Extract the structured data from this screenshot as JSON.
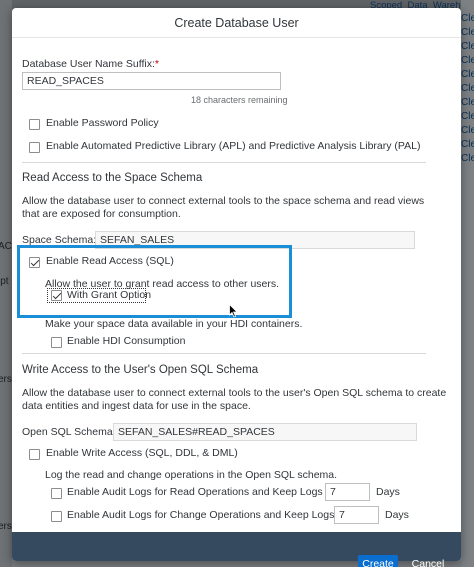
{
  "background": {
    "top_link": "Scoped_Data_Warehouse_C",
    "right_items": [
      "Cle",
      "Cle",
      "Cle",
      "Cle",
      "Cle",
      "Cle",
      "Cle",
      "Cle",
      "Cle",
      "Cle",
      "Cle"
    ],
    "left_fragments": [
      "AC",
      "ipt",
      "ers",
      "ers"
    ]
  },
  "dialog": {
    "title": "Create Database User",
    "suffix": {
      "label": "Database User Name Suffix:",
      "required_mark": "*",
      "value": "READ_SPACES",
      "remaining": "18 characters remaining"
    },
    "enable_password_policy": {
      "label": "Enable Password Policy",
      "checked": false
    },
    "enable_apl": {
      "label": "Enable Automated Predictive Library (APL) and Predictive Analysis Library (PAL)",
      "checked": false
    },
    "read_access": {
      "title": "Read Access to the Space Schema",
      "description": "Allow the database user to connect external tools to the space schema and read views that are exposed for consumption.",
      "schema_label": "Space Schema:",
      "schema_value": "SEFAN_SALES",
      "enable_read": {
        "label": "Enable Read Access (SQL)",
        "checked": true
      },
      "grant_description": "Allow the user to grant read access to other users.",
      "with_grant": {
        "label": "With Grant Option",
        "checked": true
      },
      "hdi_description": "Make your space data available in your HDI containers.",
      "enable_hdi": {
        "label": "Enable HDI Consumption",
        "checked": false
      }
    },
    "write_access": {
      "title": "Write Access to the User's Open SQL Schema",
      "description": "Allow the database user to connect external tools to the user's Open SQL schema to create data entities and ingest data for use in the space.",
      "schema_label": "Open SQL Schema:",
      "schema_value": "SEFAN_SALES#READ_SPACES",
      "enable_write": {
        "label": "Enable Write Access (SQL, DDL, & DML)",
        "checked": false
      },
      "log_description": "Log the read and change operations in the Open SQL schema.",
      "audit_read": {
        "label": "Enable Audit Logs for Read Operations and Keep Logs for",
        "days": "7",
        "unit": "Days",
        "checked": false
      },
      "audit_change": {
        "label": "Enable Audit Logs for Change Operations and Keep Logs for",
        "days": "7",
        "unit": "Days",
        "checked": false
      }
    },
    "footer": {
      "create_label": "Create",
      "cancel_label": "Cancel"
    }
  },
  "colors": {
    "accent": "#0a6ed1",
    "highlight": "#1a8fd8",
    "footer": "#354a5f",
    "required": "#bb0000"
  }
}
